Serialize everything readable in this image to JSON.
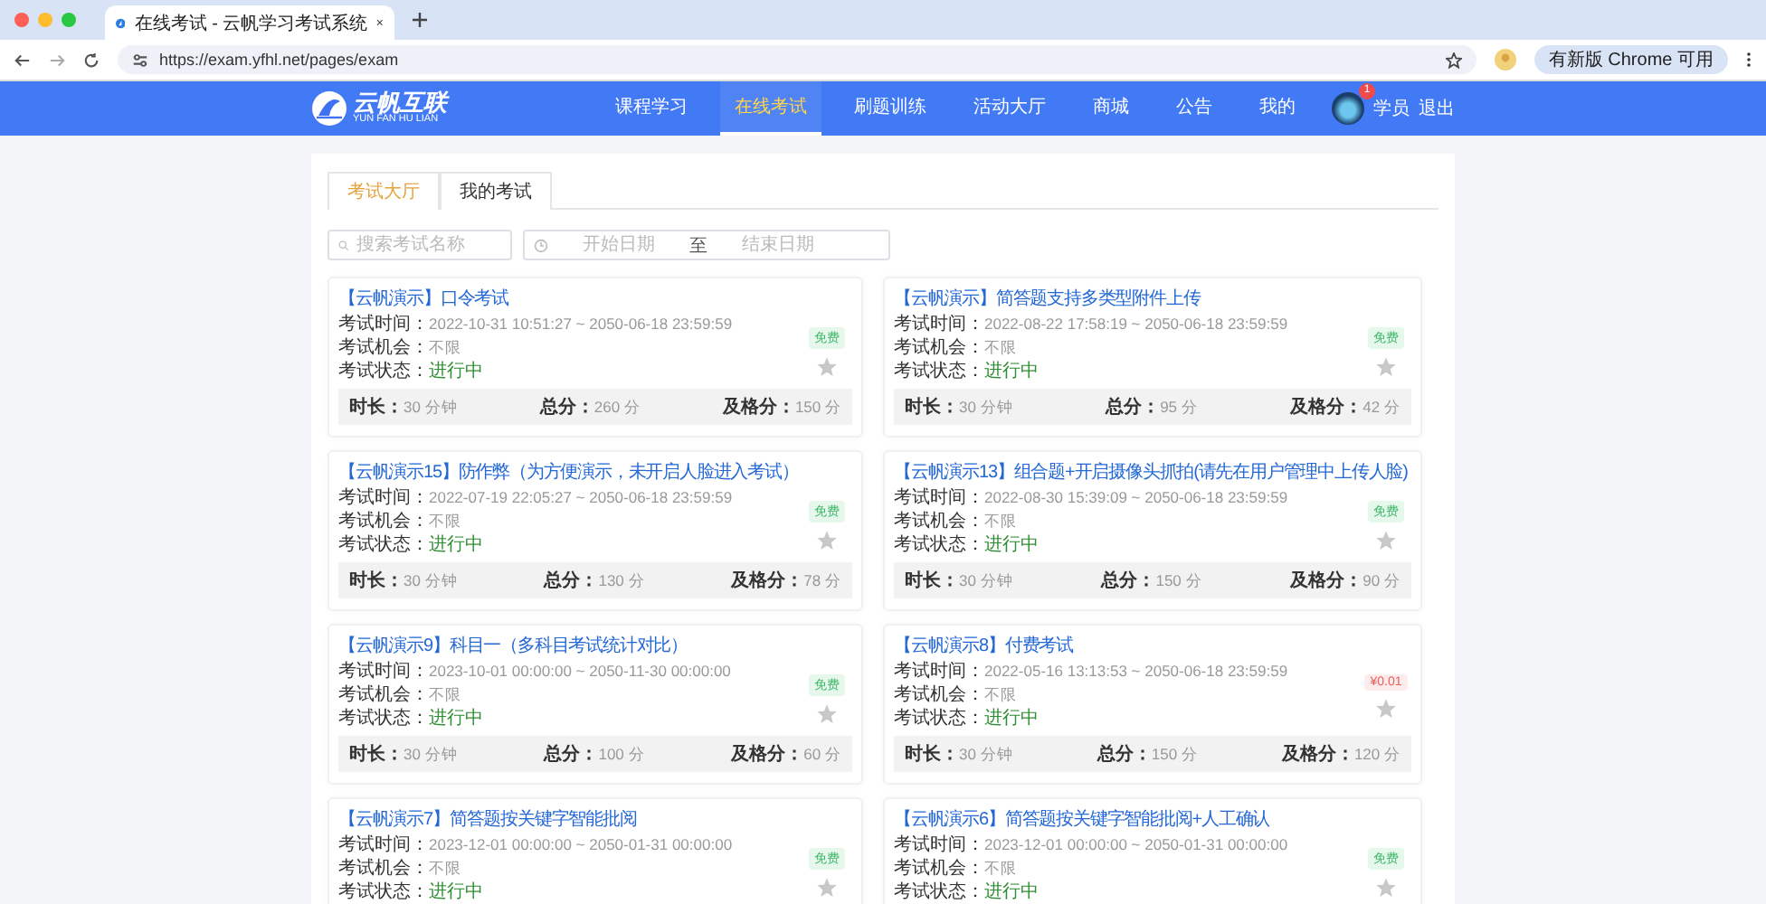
{
  "browser": {
    "tab_title": "在线考试 - 云帆学习考试系统",
    "url": "https://exam.yfhl.net/pages/exam",
    "update_button": "有新版 Chrome 可用"
  },
  "header": {
    "logo_text": "云帆互联",
    "logo_subtext": "YUN FAN HU LIAN",
    "nav": [
      {
        "label": "课程学习",
        "selected": false
      },
      {
        "label": "在线考试",
        "selected": true
      },
      {
        "label": "刷题训练",
        "selected": false
      },
      {
        "label": "活动大厅",
        "selected": false
      },
      {
        "label": "商城",
        "selected": false
      },
      {
        "label": "公告",
        "selected": false
      },
      {
        "label": "我的",
        "selected": false
      }
    ],
    "user": {
      "badge": "1",
      "name": "学员",
      "logout": "退出"
    }
  },
  "tabs": [
    {
      "label": "考试大厅",
      "selected": true
    },
    {
      "label": "我的考试",
      "selected": false
    }
  ],
  "filters": {
    "search_placeholder": "搜索考试名称",
    "start_placeholder": "开始日期",
    "separator": "至",
    "end_placeholder": "结束日期"
  },
  "exams": [
    {
      "title": "【云帆演示】口令考试",
      "time_label": "考试时间：",
      "time": "2022-10-31 10:51:27 ~ 2050-06-18 23:59:59",
      "chance_label": "考试机会：",
      "chance": "不限",
      "status_label": "考试状态：",
      "status": "进行中",
      "price": {
        "text": "免费",
        "kind": "free"
      },
      "favorited": false,
      "duration_label": "时长：",
      "duration": "30 分钟",
      "total_label": "总分：",
      "total": "260 分",
      "pass_label": "及格分：",
      "pass": "150 分"
    },
    {
      "title": "【云帆演示】简答题支持多类型附件上传",
      "time_label": "考试时间：",
      "time": "2022-08-22 17:58:19 ~ 2050-06-18 23:59:59",
      "chance_label": "考试机会：",
      "chance": "不限",
      "status_label": "考试状态：",
      "status": "进行中",
      "price": {
        "text": "免费",
        "kind": "free"
      },
      "favorited": false,
      "duration_label": "时长：",
      "duration": "30 分钟",
      "total_label": "总分：",
      "total": "95 分",
      "pass_label": "及格分：",
      "pass": "42 分"
    },
    {
      "title": "【云帆演示15】防作弊（为方便演示，未开启人脸进入考试）",
      "time_label": "考试时间：",
      "time": "2022-07-19 22:05:27 ~ 2050-06-18 23:59:59",
      "chance_label": "考试机会：",
      "chance": "不限",
      "status_label": "考试状态：",
      "status": "进行中",
      "price": {
        "text": "免费",
        "kind": "free"
      },
      "favorited": false,
      "duration_label": "时长：",
      "duration": "30 分钟",
      "total_label": "总分：",
      "total": "130 分",
      "pass_label": "及格分：",
      "pass": "78 分"
    },
    {
      "title": "【云帆演示13】组合题+开启摄像头抓拍(请先在用户管理中上传人脸)",
      "time_label": "考试时间：",
      "time": "2022-08-30 15:39:09 ~ 2050-06-18 23:59:59",
      "chance_label": "考试机会：",
      "chance": "不限",
      "status_label": "考试状态：",
      "status": "进行中",
      "price": {
        "text": "免费",
        "kind": "free"
      },
      "favorited": false,
      "duration_label": "时长：",
      "duration": "30 分钟",
      "total_label": "总分：",
      "total": "150 分",
      "pass_label": "及格分：",
      "pass": "90 分"
    },
    {
      "title": "【云帆演示9】科目一（多科目考试统计对比）",
      "time_label": "考试时间：",
      "time": "2023-10-01 00:00:00 ~ 2050-11-30 00:00:00",
      "chance_label": "考试机会：",
      "chance": "不限",
      "status_label": "考试状态：",
      "status": "进行中",
      "price": {
        "text": "免费",
        "kind": "free"
      },
      "favorited": false,
      "duration_label": "时长：",
      "duration": "30 分钟",
      "total_label": "总分：",
      "total": "100 分",
      "pass_label": "及格分：",
      "pass": "60 分"
    },
    {
      "title": "【云帆演示8】付费考试",
      "time_label": "考试时间：",
      "time": "2022-05-16 13:13:53 ~ 2050-06-18 23:59:59",
      "chance_label": "考试机会：",
      "chance": "不限",
      "status_label": "考试状态：",
      "status": "进行中",
      "price": {
        "text": "¥0.01",
        "kind": "paid"
      },
      "favorited": false,
      "duration_label": "时长：",
      "duration": "30 分钟",
      "total_label": "总分：",
      "total": "150 分",
      "pass_label": "及格分：",
      "pass": "120 分"
    },
    {
      "title": "【云帆演示7】简答题按关键字智能批阅",
      "time_label": "考试时间：",
      "time": "2023-12-01 00:00:00 ~ 2050-01-31 00:00:00",
      "chance_label": "考试机会：",
      "chance": "不限",
      "status_label": "考试状态：",
      "status": "进行中",
      "price": {
        "text": "免费",
        "kind": "free"
      },
      "favorited": false
    },
    {
      "title": "【云帆演示6】简答题按关键字智能批阅+人工确认",
      "time_label": "考试时间：",
      "time": "2023-12-01 00:00:00 ~ 2050-01-31 00:00:00",
      "chance_label": "考试机会：",
      "chance": "不限",
      "status_label": "考试状态：",
      "status": "进行中",
      "price": {
        "text": "免费",
        "kind": "free"
      },
      "favorited": false
    }
  ]
}
